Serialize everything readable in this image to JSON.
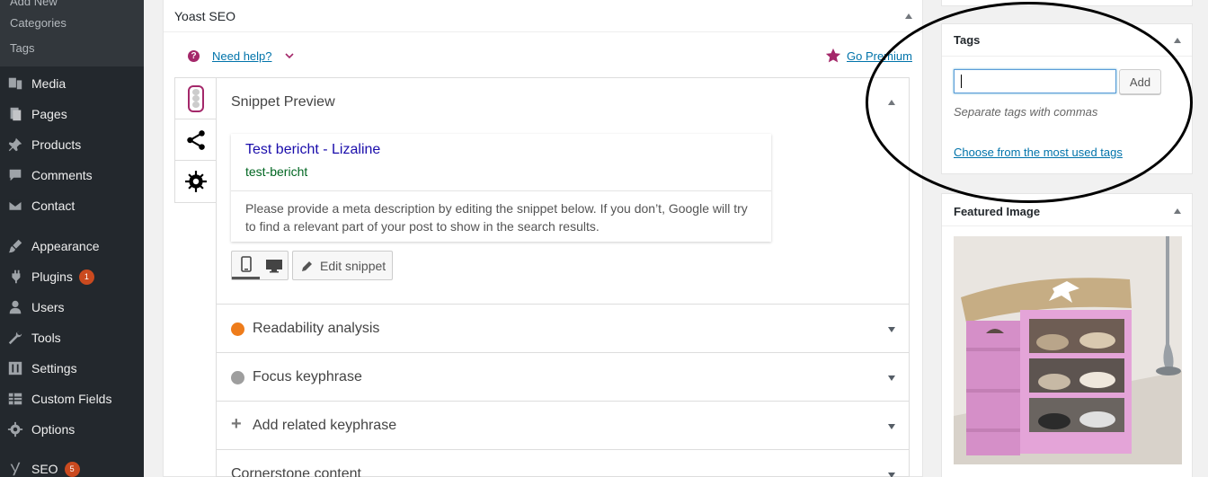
{
  "sidebar": {
    "submenu": [
      "Add New",
      "Categories",
      "Tags"
    ],
    "items": [
      {
        "label": "Media",
        "icon": "media-icon"
      },
      {
        "label": "Pages",
        "icon": "pages-icon"
      },
      {
        "label": "Products",
        "icon": "pin-icon"
      },
      {
        "label": "Comments",
        "icon": "comments-icon"
      },
      {
        "label": "Contact",
        "icon": "envelope-icon"
      },
      {
        "label": "Appearance",
        "icon": "brush-icon"
      },
      {
        "label": "Plugins",
        "icon": "plugin-icon",
        "badge": "1"
      },
      {
        "label": "Users",
        "icon": "users-icon"
      },
      {
        "label": "Tools",
        "icon": "wrench-icon"
      },
      {
        "label": "Settings",
        "icon": "settings-icon"
      },
      {
        "label": "Custom Fields",
        "icon": "table-icon"
      },
      {
        "label": "Options",
        "icon": "gear-icon"
      },
      {
        "label": "SEO",
        "icon": "yoast-icon",
        "badge": "5"
      }
    ]
  },
  "yoast": {
    "title": "Yoast SEO",
    "help_link": "Need help?",
    "premium_link": "Go Premium",
    "snippet_section": "Snippet Preview",
    "snippet": {
      "title": "Test bericht - Lizaline",
      "url": "test-bericht",
      "description": "Please provide a meta description by editing the snippet below. If you don’t, Google will try to find a relevant part of your post to show in the search results."
    },
    "edit_snippet": "Edit snippet",
    "sections": [
      {
        "label": "Readability analysis"
      },
      {
        "label": "Focus keyphrase"
      },
      {
        "label": "Add related keyphrase"
      },
      {
        "label": "Cornerstone content"
      }
    ]
  },
  "tags_box": {
    "title": "Tags",
    "input_value": "",
    "add_label": "Add",
    "hint": "Separate tags with commas",
    "choose_link": "Choose from the most used tags"
  },
  "featured_image": {
    "title": "Featured Image"
  },
  "colors": {
    "accent": "#a4286a",
    "link": "#0073aa",
    "admin_bar": "#23282d",
    "badge": "#ca4a1f"
  }
}
